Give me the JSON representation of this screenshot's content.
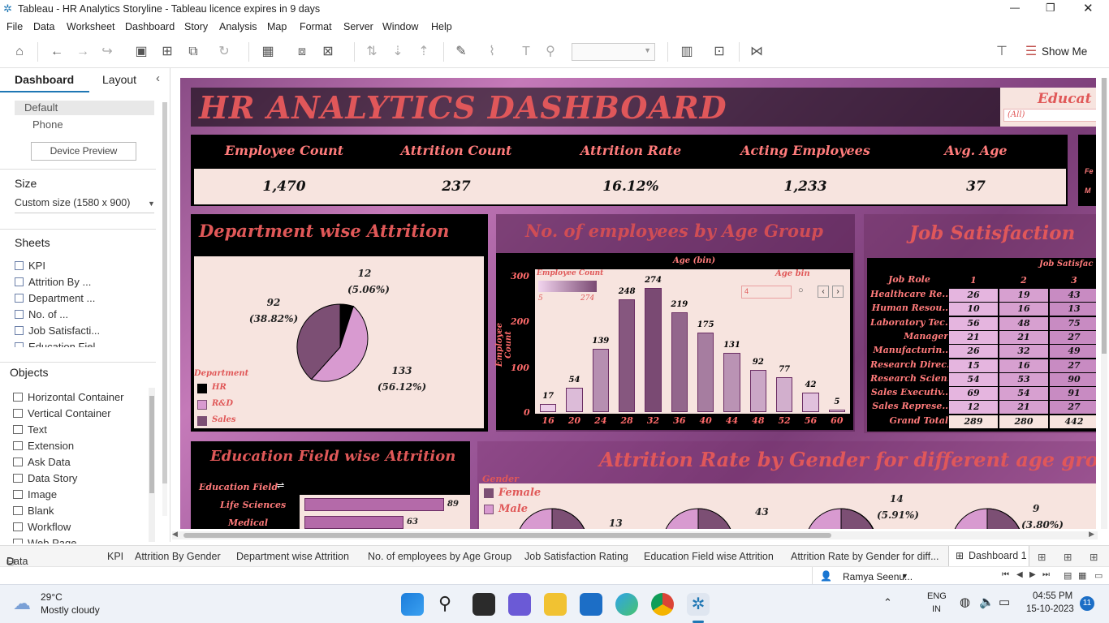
{
  "window": {
    "title": "Tableau - HR Analytics Storyline - Tableau licence expires in 9 days",
    "min": "—",
    "max": "❐",
    "close": "✕"
  },
  "menu": [
    "File",
    "Data",
    "Worksheet",
    "Dashboard",
    "Story",
    "Analysis",
    "Map",
    "Format",
    "Server",
    "Window",
    "Help"
  ],
  "toolbar": {
    "show_me": "Show Me"
  },
  "left": {
    "tab_dashboard": "Dashboard",
    "tab_layout": "Layout",
    "devices": [
      "Default",
      "Phone"
    ],
    "device_preview": "Device Preview",
    "size_header": "Size",
    "size_value": "Custom size (1580 x 900)",
    "sheets_header": "Sheets",
    "sheets": [
      "KPI",
      "Attrition By ...",
      "Department ...",
      "No. of ...",
      "Job Satisfacti...",
      "Education Fiel..."
    ],
    "objects_header": "Objects",
    "objects": [
      "Horizontal Container",
      "Vertical Container",
      "Text",
      "Extension",
      "Ask Data",
      "Data Story",
      "Image",
      "Blank",
      "Workflow",
      "Web Page"
    ]
  },
  "dashboard": {
    "title": "HR ANALYTICS DASHBOARD",
    "filter_label": "Educat",
    "filter_value": "(All)",
    "kpis": [
      {
        "label": "Employee Count",
        "value": "1,470"
      },
      {
        "label": "Attrition Count",
        "value": "237"
      },
      {
        "label": "Attrition Rate",
        "value": "16.12%"
      },
      {
        "label": "Acting Employees",
        "value": "1,233"
      },
      {
        "label": "Avg. Age",
        "value": "37"
      }
    ],
    "side_labels": [
      "Fe",
      "M"
    ],
    "dept": {
      "title": "Department wise Attrition",
      "legend_title": "Department",
      "legend": [
        "HR",
        "R&D",
        "Sales"
      ],
      "labels": [
        {
          "v": "12",
          "p": "(5.06%)"
        },
        {
          "v": "133",
          "p": "(56.12%)"
        },
        {
          "v": "92",
          "p": "(38.82%)"
        }
      ]
    },
    "age": {
      "title": "No. of employees by Age Group",
      "header": "Age (bin)",
      "ylabel": "Employee Count",
      "legend_title": "Employee Count",
      "legend_min": "5",
      "legend_max": "274",
      "param_title": "Age bin",
      "param_value": "4",
      "yticks": [
        "300",
        "200",
        "100",
        "0"
      ]
    },
    "job": {
      "title": "Job Satisfaction",
      "header": "Job Satisfac",
      "col_head": "Job Role",
      "cols": [
        "1",
        "2",
        "3"
      ],
      "rows": [
        {
          "role": "Healthcare Re..",
          "v": [
            "26",
            "19",
            "43"
          ]
        },
        {
          "role": "Human Resou..",
          "v": [
            "10",
            "16",
            "13"
          ]
        },
        {
          "role": "Laboratory Tec..",
          "v": [
            "56",
            "48",
            "75"
          ]
        },
        {
          "role": "Manager",
          "v": [
            "21",
            "21",
            "27"
          ]
        },
        {
          "role": "Manufacturin..",
          "v": [
            "26",
            "32",
            "49"
          ]
        },
        {
          "role": "Research Direc..",
          "v": [
            "15",
            "16",
            "27"
          ]
        },
        {
          "role": "Research Scien..",
          "v": [
            "54",
            "53",
            "90"
          ]
        },
        {
          "role": "Sales Executiv..",
          "v": [
            "69",
            "54",
            "91"
          ]
        },
        {
          "role": "Sales Represe..",
          "v": [
            "12",
            "21",
            "27"
          ]
        },
        {
          "role": "Grand Total",
          "v": [
            "289",
            "280",
            "442"
          ]
        }
      ]
    },
    "edu": {
      "title": "Education Field wise Attrition",
      "header": "Education Field",
      "rows": [
        {
          "label": "Life Sciences",
          "value": "89"
        },
        {
          "label": "Medical",
          "value": "63"
        }
      ]
    },
    "gender": {
      "title": "Attrition Rate by Gender for different age group",
      "legend_title": "Gender",
      "legend": [
        "Female",
        "Male"
      ],
      "labels": [
        {
          "v": "13",
          "p": ""
        },
        {
          "v": "43",
          "p": ""
        },
        {
          "v": "14",
          "p": "(5.91%)"
        },
        {
          "v": "9",
          "p": "(3.80%)"
        }
      ]
    }
  },
  "chart_data": {
    "type": "bar",
    "title": "No. of employees by Age Group",
    "xlabel": "Age (bin)",
    "ylabel": "Employee Count",
    "ylim": [
      0,
      300
    ],
    "categories": [
      "16",
      "20",
      "24",
      "28",
      "32",
      "36",
      "40",
      "44",
      "48",
      "52",
      "56",
      "60"
    ],
    "values": [
      17,
      54,
      139,
      248,
      274,
      219,
      175,
      131,
      92,
      77,
      42,
      5
    ]
  },
  "tabs": [
    "Data Source",
    "KPI",
    "Attrition By Gender",
    "Department wise Attrition",
    "No. of employees by Age Group",
    "Job Satisfaction Rating",
    "Education Field wise Attrition",
    "Attrition Rate by Gender for diff...",
    "Dashboard 1"
  ],
  "status": {
    "user": "Ramya Seenu..."
  },
  "taskbar": {
    "weather_temp": "29°C",
    "weather_desc": "Mostly cloudy",
    "lang1": "ENG",
    "lang2": "IN",
    "time": "04:55 PM",
    "date": "15-10-2023",
    "notif": "11"
  },
  "colors": {
    "accent": "#e05858",
    "panel": "#000000",
    "pink": "#f7e4df",
    "purple": "#7a4a73",
    "light": "#d28ac9"
  }
}
